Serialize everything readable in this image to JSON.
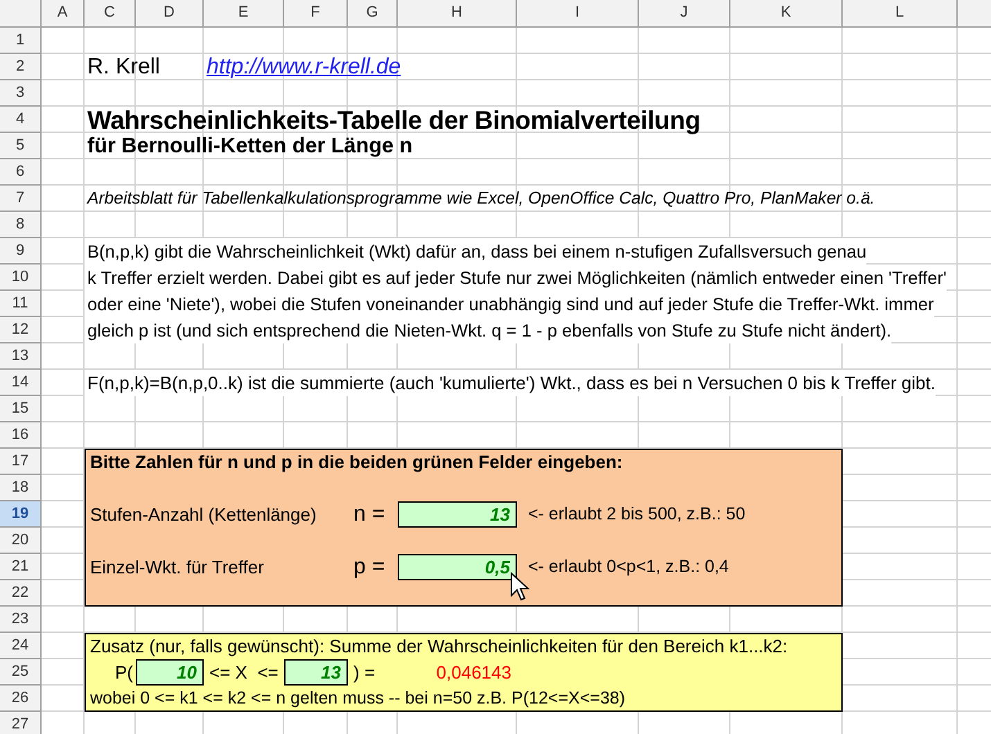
{
  "columns": [
    "A",
    "C",
    "D",
    "E",
    "F",
    "G",
    "H",
    "I",
    "J",
    "K",
    "L"
  ],
  "rows": [
    {
      "label": "1",
      "selected": false
    },
    {
      "label": "2",
      "selected": false
    },
    {
      "label": "3",
      "selected": false
    },
    {
      "label": "4",
      "selected": false
    },
    {
      "label": "5",
      "selected": false
    },
    {
      "label": "6",
      "selected": false
    },
    {
      "label": "7",
      "selected": false
    },
    {
      "label": "8",
      "selected": false
    },
    {
      "label": "9",
      "selected": false
    },
    {
      "label": "10",
      "selected": false
    },
    {
      "label": "11",
      "selected": false
    },
    {
      "label": "12",
      "selected": false
    },
    {
      "label": "13",
      "selected": false
    },
    {
      "label": "14",
      "selected": false
    },
    {
      "label": "15",
      "selected": false
    },
    {
      "label": "16",
      "selected": false
    },
    {
      "label": "17",
      "selected": false
    },
    {
      "label": "18",
      "selected": false
    },
    {
      "label": "19",
      "selected": true
    },
    {
      "label": "20",
      "selected": false
    },
    {
      "label": "21",
      "selected": false
    },
    {
      "label": "22",
      "selected": false
    },
    {
      "label": "23",
      "selected": false
    },
    {
      "label": "24",
      "selected": false
    },
    {
      "label": "25",
      "selected": false
    },
    {
      "label": "26",
      "selected": false
    },
    {
      "label": "27",
      "selected": false
    }
  ],
  "author": "R. Krell",
  "link": "http://www.r-krell.de",
  "title": "Wahrscheinlichkeits-Tabelle der Binomialverteilung",
  "subtitle": "für Bernoulli-Ketten der Länge n",
  "note": "Arbeitsblatt für Tabellenkalkulationsprogramme wie Excel, OpenOffice Calc, Quattro Pro, PlanMaker o.ä.",
  "description_lines": [
    "B(n,p,k) gibt die Wahrscheinlichkeit (Wkt) dafür an, dass bei einem n-stufigen Zufallsversuch genau",
    "k Treffer erzielt werden. Dabei gibt es auf jeder Stufe nur zwei Möglichkeiten (nämlich entweder einen 'Treffer'",
    "oder eine 'Niete'), wobei die Stufen voneinander unabhängig sind und auf jeder Stufe die Treffer-Wkt. immer",
    "gleich p ist (und sich entsprechend die Nieten-Wkt. q = 1 - p ebenfalls von Stufe zu Stufe nicht ändert)."
  ],
  "cumulative_line": "F(n,p,k)=B(n,p,0..k) ist die summierte (auch 'kumulierte') Wkt., dass es bei n Versuchen 0 bis k Treffer gibt.",
  "input_panel": {
    "heading": "Bitte Zahlen für n und p in die beiden grünen Felder eingeben:",
    "fields": [
      {
        "label": "Stufen-Anzahl (Kettenlänge)",
        "symbol": "n =",
        "value": "13",
        "hint": "<- erlaubt 2 bis 500, z.B.: 50"
      },
      {
        "label": "Einzel-Wkt. für Treffer",
        "symbol": "p =",
        "value": "0,5",
        "hint": "<- erlaubt 0<p<1, z.B.: 0,4"
      }
    ]
  },
  "range_panel": {
    "heading": "Zusatz (nur, falls gewünscht): Summe der Wahrscheinlichkeiten für den Bereich k1...k2:",
    "prefix": "P(",
    "k1": "10",
    "between": "<= X  <=",
    "k2": "13",
    "suffix": ") =",
    "result": "0,046143",
    "footnote": "wobei 0 <= k1 <= k2 <= n gelten muss -- bei n=50 z.B. P(12<=X<=38)"
  }
}
